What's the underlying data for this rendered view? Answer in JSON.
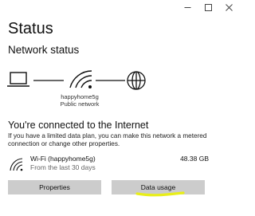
{
  "window": {
    "controls": [
      {
        "name": "minimize",
        "glyph": "–"
      },
      {
        "name": "maximize",
        "glyph": "☐"
      },
      {
        "name": "close",
        "glyph": "✕"
      }
    ]
  },
  "page": {
    "title": "Status",
    "section_title": "Network status"
  },
  "diagram": {
    "network_name": "happyhome5g",
    "network_type": "Public network",
    "icons": [
      "computer-icon",
      "wifi-icon",
      "globe-icon"
    ]
  },
  "connection": {
    "title": "You're connected to the Internet",
    "description": "If you have a limited data plan, you can make this network a metered connection or change other properties."
  },
  "usage": {
    "connection_name": "Wi-Fi (happyhome5g)",
    "period": "From the last 30 days",
    "amount": "48.38 GB"
  },
  "buttons": {
    "properties_label": "Properties",
    "data_usage_label": "Data usage"
  },
  "colors": {
    "button_bg": "#cccccc",
    "highlight": "#e8ee1a"
  }
}
